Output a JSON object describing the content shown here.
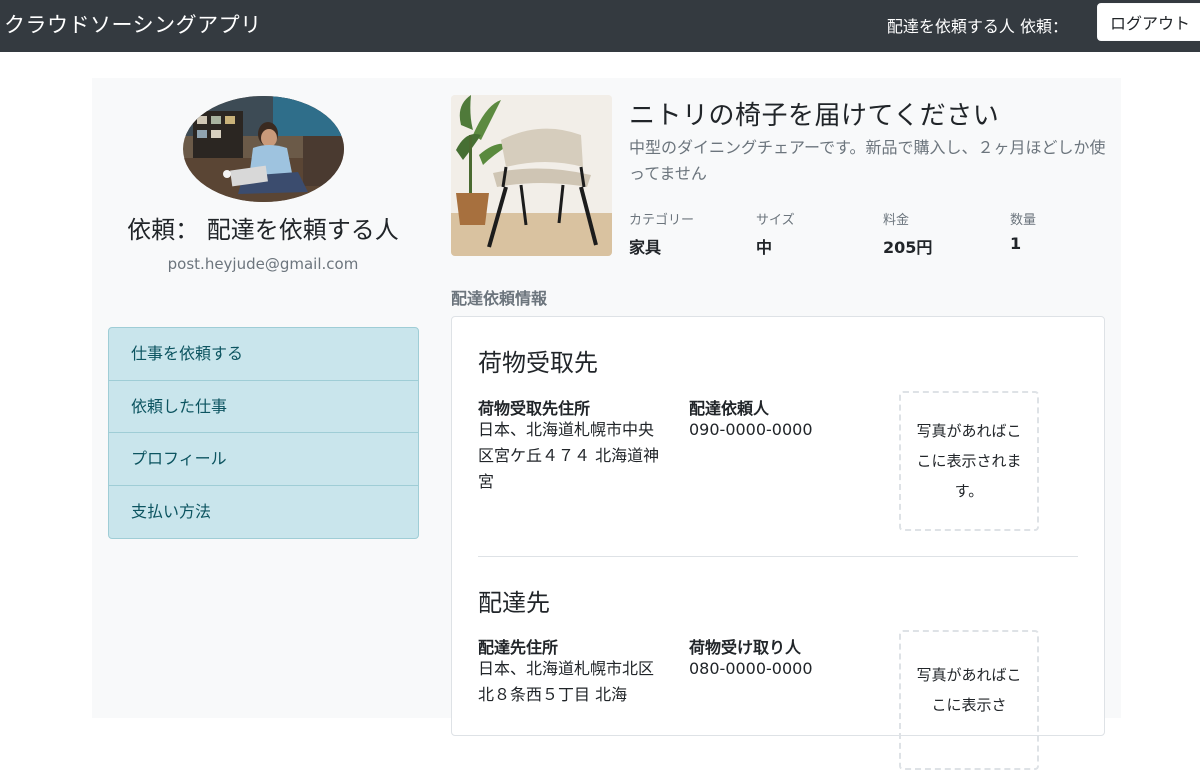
{
  "navbar": {
    "brand": "クラウドソーシングアプリ",
    "user_label": "配達を依頼する人 依頼：",
    "logout_label": "ログアウト"
  },
  "profile": {
    "title": "依頼： 配達を依頼する人",
    "email": "post.heyjude@gmail.com"
  },
  "menu": {
    "items": [
      "仕事を依頼する",
      "依頼した仕事",
      "プロフィール",
      "支払い方法"
    ]
  },
  "product": {
    "title": "ニトリの椅子を届けてください",
    "description": "中型のダイニングチェアーです。新品で購入し、２ヶ月ほどしか使ってません",
    "meta": [
      {
        "label": "カテゴリー",
        "value": "家具"
      },
      {
        "label": "サイズ",
        "value": "中"
      },
      {
        "label": "料金",
        "value": "205円"
      },
      {
        "label": "数量",
        "value": "1"
      }
    ]
  },
  "delivery": {
    "section_label": "配達依頼情報",
    "pickup": {
      "heading": "荷物受取先",
      "address_label": "荷物受取先住所",
      "address_value": "日本、北海道札幌市中央区宮ケ丘４７４ 北海道神宮",
      "person_label": "配達依頼人",
      "person_value": "090-0000-0000",
      "photo_placeholder": "写真があればここに表示されます。"
    },
    "dropoff": {
      "heading": "配達先",
      "address_label": "配達先住所",
      "address_value": "日本、北海道札幌市北区北８条西５丁目 北海",
      "person_label": "荷物受け取り人",
      "person_value": "080-0000-0000",
      "photo_placeholder": "写真があればここに表示さ"
    }
  },
  "colors": {
    "navbar_bg": "#343a40",
    "menu_bg": "#c9e5ec",
    "menu_text": "#0c5460"
  }
}
